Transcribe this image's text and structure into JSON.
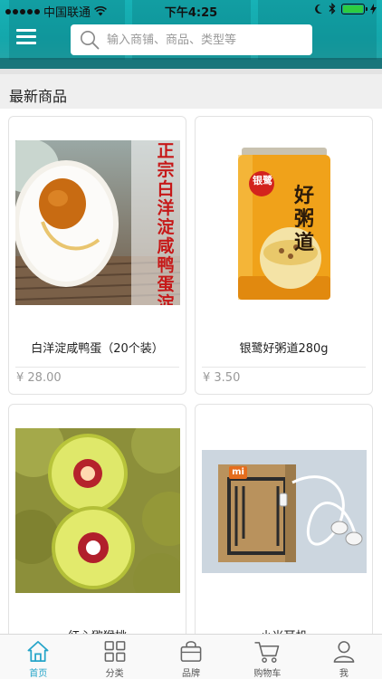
{
  "status_bar": {
    "carrier": "中国联通",
    "time": "下午4:25"
  },
  "header": {
    "search_placeholder": "输入商铺、商品、类型等"
  },
  "section": {
    "title": "最新商品"
  },
  "products": [
    {
      "name": "白洋淀咸鸭蛋（20个装）",
      "price": "¥ 28.00",
      "image_text": "正宗白洋淀咸鸭蛋 淀区散养"
    },
    {
      "name": "银鹭好粥道280g",
      "price": "¥ 3.50",
      "image_brand": "银鹭",
      "image_text": "好粥道"
    },
    {
      "name": "红心猕猴桃",
      "price": ""
    },
    {
      "name": "小米耳机",
      "price": "",
      "image_brand": "mi"
    }
  ],
  "tabs": [
    {
      "label": "首页",
      "icon": "home-icon",
      "active": true
    },
    {
      "label": "分类",
      "icon": "grid-icon",
      "active": false
    },
    {
      "label": "品牌",
      "icon": "bag-icon",
      "active": false
    },
    {
      "label": "购物车",
      "icon": "cart-icon",
      "active": false
    },
    {
      "label": "我",
      "icon": "user-icon",
      "active": false
    }
  ],
  "colors": {
    "header": "#17b2b6",
    "active_tab": "#26a5c9",
    "price": "#999999"
  }
}
